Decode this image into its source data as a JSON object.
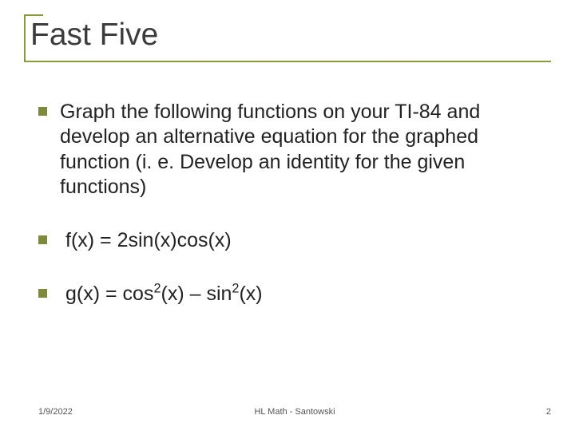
{
  "title": "Fast Five",
  "bullets": [
    {
      "text": "Graph the following functions on your TI-84 and develop an alternative equation for the graphed function (i. e. Develop an identity for the given functions)",
      "indent": false
    },
    {
      "text": "f(x) = 2sin(x)cos(x)",
      "indent": true
    },
    {
      "html": "g(x) = cos<sup>2</sup>(x) – sin<sup>2</sup>(x)",
      "indent": true
    }
  ],
  "footer": {
    "date": "1/9/2022",
    "center": "HL Math - Santowski",
    "page": "2"
  }
}
